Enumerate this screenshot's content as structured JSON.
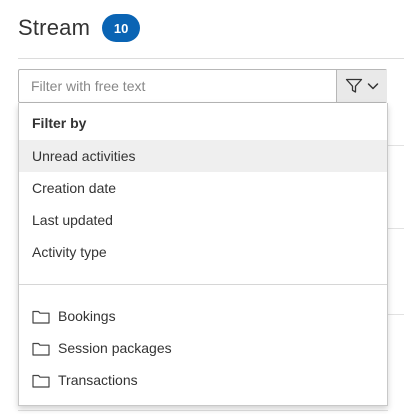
{
  "header": {
    "title": "Stream",
    "count": "10"
  },
  "filter": {
    "placeholder": "Filter with free text",
    "toggle_icon": "filter-funnel-icon",
    "caret_icon": "chevron-down-icon"
  },
  "dropdown": {
    "heading": "Filter by",
    "items": [
      {
        "label": "Unread activities",
        "active": true
      },
      {
        "label": "Creation date",
        "active": false
      },
      {
        "label": "Last updated",
        "active": false
      },
      {
        "label": "Activity type",
        "active": false
      }
    ],
    "folders": [
      {
        "label": "Bookings",
        "icon": "folder-icon"
      },
      {
        "label": "Session packages",
        "icon": "folder-icon"
      },
      {
        "label": "Transactions",
        "icon": "folder-icon"
      }
    ]
  },
  "colors": {
    "badge": "#0a64b4",
    "active_row": "#efefef",
    "toggle_bg": "#e9e9e9"
  }
}
